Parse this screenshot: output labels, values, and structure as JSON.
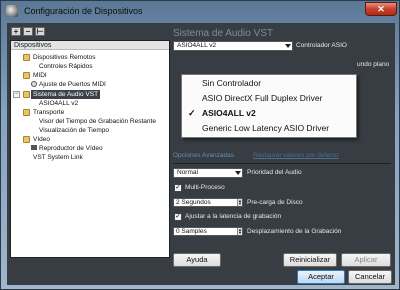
{
  "window": {
    "title": "Configuración de Dispositivos",
    "close_glyph": "✕"
  },
  "toolbar": {
    "add_glyph": "+",
    "remove_glyph": "−",
    "reset_glyph": "⊢"
  },
  "tree": {
    "header": "Dispositivos",
    "items": [
      {
        "label": "Dispositivos Remotos"
      },
      {
        "label": "Controles Rápidos"
      },
      {
        "label": "MIDI"
      },
      {
        "label": "Ajuste de Puertos MIDI"
      },
      {
        "label": "Sistema de Audio VST"
      },
      {
        "label": "ASIO4ALL v2"
      },
      {
        "label": "Transporte"
      },
      {
        "label": "Visor del Tiempo de Grabación Restante"
      },
      {
        "label": "Visualización de Tiempo"
      },
      {
        "label": "Vídeo"
      },
      {
        "label": "Reproductor de Vídeo"
      },
      {
        "label": "VST System Link"
      }
    ]
  },
  "panel": {
    "title": "Sistema de Audio VST",
    "driver_select": "ASIO4ALL v2",
    "driver_label": "Controlador ASIO",
    "clipped_right_text": "undo plano",
    "advanced_label": "Opciones Avanzadas",
    "reset_defaults_link": "Restaurar valores por defecto",
    "priority_select": "Normal",
    "priority_label": "Prioridad del Audio",
    "multiprocess_label": "Multi-Proceso",
    "multiprocess_checked": "✓",
    "preload_value": "2 Segundos",
    "preload_label": "Pre-carga de Disco",
    "latency_adjust_label": "Ajustar a la latencia de grabación",
    "latency_adjust_checked": "✓",
    "offset_value": "0 Samples",
    "offset_label": "Desplazamiento de la Grabación"
  },
  "dropdown": {
    "items": [
      {
        "label": "Sin Controlador",
        "selected": false
      },
      {
        "label": "ASIO DirectX Full Duplex Driver",
        "selected": false
      },
      {
        "label": "ASIO4ALL v2",
        "selected": true
      },
      {
        "label": "Generic Low Latency ASIO Driver",
        "selected": false
      }
    ],
    "check_glyph": "✓"
  },
  "buttons": {
    "help": "Ayuda",
    "reset": "Reinicializar",
    "apply": "Aplicar",
    "ok": "Aceptar",
    "cancel": "Cancelar"
  },
  "colors": {
    "titlebar": "#6f8aa8",
    "client_bg": "#383d43",
    "selection": "#3d4248",
    "section_blue": "#5f8fb8"
  }
}
